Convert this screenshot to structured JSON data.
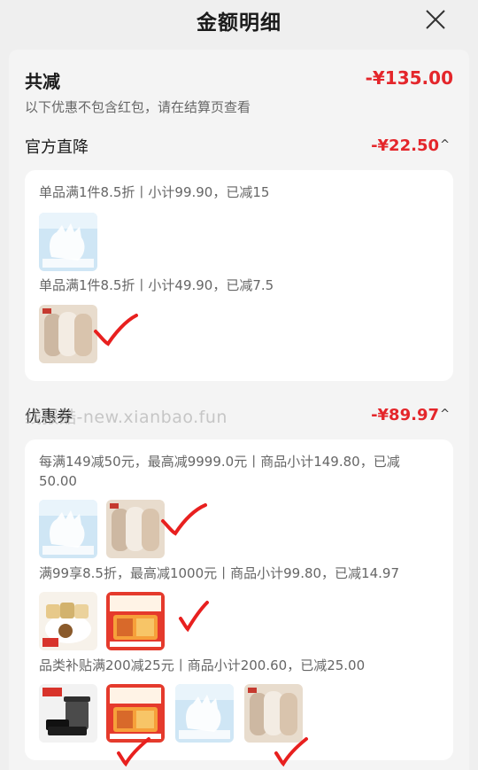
{
  "header": {
    "title": "金额明细"
  },
  "summary": {
    "label": "共减",
    "amount": "-¥135.00",
    "note": "以下优惠不包含红包，请在结算页查看"
  },
  "sections": [
    {
      "title": "官方直降",
      "amount": "-¥22.50",
      "chevron": "^",
      "rules": [
        {
          "text": "单品满1件8.5折丨小计99.90，已减15"
        },
        {
          "text": "单品满1件8.5折丨小计49.90，已减7.5"
        }
      ]
    },
    {
      "title": "优惠券",
      "amount": "-¥89.97",
      "chevron": "^",
      "rules": [
        {
          "text": "每满149减50元，最高减9999.0元丨商品小计149.80，已减50.00"
        },
        {
          "text": "满99享8.5折，最高减1000元丨商品小计99.80，已减14.97"
        },
        {
          "text": "品类补贴满200减25元丨商品小计200.60，已减25.00"
        }
      ]
    }
  ],
  "watermark": "线报酷-new.xianbao.fun",
  "colors": {
    "accent": "#e4262b",
    "check": "#e8201f",
    "background": "#efefef",
    "panel": "#ffffff"
  },
  "icons": {
    "close": "close-icon",
    "chevron": "chevron-up-icon"
  }
}
